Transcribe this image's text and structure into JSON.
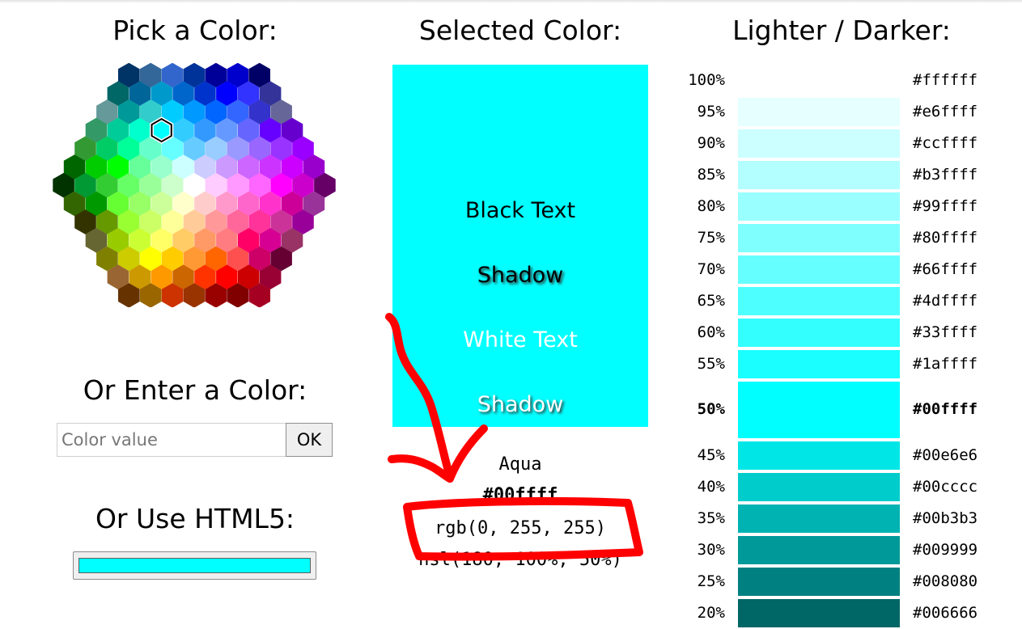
{
  "picker": {
    "title": "Pick a Color:",
    "selected_color": "#00ffff",
    "colors": [
      "#003366",
      "#336699",
      "#3366cc",
      "#003399",
      "#000099",
      "#0000cc",
      "#000066",
      "#006666",
      "#006699",
      "#0099cc",
      "#0066cc",
      "#0033cc",
      "#0000ff",
      "#3333ff",
      "#333399",
      "#669999",
      "#009999",
      "#33cccc",
      "#00ccff",
      "#0099ff",
      "#0066ff",
      "#3366ff",
      "#3333cc",
      "#666699",
      "#339966",
      "#00cc99",
      "#00ffcc",
      "#00ffff",
      "#33ccff",
      "#3399ff",
      "#6699ff",
      "#6666ff",
      "#6600ff",
      "#6600cc",
      "#339933",
      "#00cc66",
      "#00ff99",
      "#66ffcc",
      "#66ffff",
      "#66ccff",
      "#99ccff",
      "#9999ff",
      "#9966ff",
      "#9933ff",
      "#9900ff",
      "#006600",
      "#00cc00",
      "#00ff00",
      "#66ff99",
      "#99ffcc",
      "#ccffff",
      "#ccccff",
      "#cc99ff",
      "#cc66ff",
      "#cc33ff",
      "#cc00ff",
      "#9900cc",
      "#003300",
      "#009933",
      "#33cc33",
      "#66ff66",
      "#99ff99",
      "#ccffcc",
      "#ffffff",
      "#ffccff",
      "#ff99ff",
      "#ff66ff",
      "#ff00ff",
      "#cc00cc",
      "#660066",
      "#336600",
      "#009900",
      "#66ff33",
      "#99ff66",
      "#ccff99",
      "#ffffcc",
      "#ffcccc",
      "#ff99cc",
      "#ff66cc",
      "#ff33cc",
      "#cc0099",
      "#993399",
      "#333300",
      "#669900",
      "#99ff33",
      "#ccff66",
      "#ffff99",
      "#ffcc99",
      "#ff9999",
      "#ff6699",
      "#ff3399",
      "#cc3399",
      "#990099",
      "#666633",
      "#99cc00",
      "#ccff33",
      "#ffff66",
      "#ffcc66",
      "#ff9966",
      "#ff7c80",
      "#ff0066",
      "#d60093",
      "#993366",
      "#808000",
      "#cccc00",
      "#ffff00",
      "#ffcc00",
      "#ff9933",
      "#ff6600",
      "#ff5050",
      "#cc0066",
      "#660033",
      "#996633",
      "#cc9900",
      "#ff9900",
      "#cc6600",
      "#ff3300",
      "#ff0000",
      "#cc0000",
      "#990033",
      "#663300",
      "#996600",
      "#cc3300",
      "#993300",
      "#990000",
      "#800000",
      "#a50021"
    ]
  },
  "enter": {
    "title": "Or Enter a Color:",
    "placeholder": "Color value",
    "ok_label": "OK"
  },
  "html5": {
    "title": "Or Use HTML5:",
    "value": "#00ffff"
  },
  "selected": {
    "title": "Selected Color:",
    "color": "#00ffff",
    "preview_black": "Black Text",
    "preview_black_shadow": "Shadow",
    "preview_white": "White Text",
    "preview_white_shadow": "Shadow",
    "name": "Aqua",
    "hex": "#00ffff",
    "rgb": "rgb(0, 255, 255)",
    "hsl": "hsl(180, 100%, 50%)"
  },
  "shades": {
    "title": "Lighter / Darker:",
    "rows": [
      {
        "pct": "100%",
        "hex": "#ffffff"
      },
      {
        "pct": "95%",
        "hex": "#e6ffff"
      },
      {
        "pct": "90%",
        "hex": "#ccffff"
      },
      {
        "pct": "85%",
        "hex": "#b3ffff"
      },
      {
        "pct": "80%",
        "hex": "#99ffff"
      },
      {
        "pct": "75%",
        "hex": "#80ffff"
      },
      {
        "pct": "70%",
        "hex": "#66ffff"
      },
      {
        "pct": "65%",
        "hex": "#4dffff"
      },
      {
        "pct": "60%",
        "hex": "#33ffff"
      },
      {
        "pct": "55%",
        "hex": "#1affff"
      },
      {
        "pct": "50%",
        "hex": "#00ffff"
      },
      {
        "pct": "45%",
        "hex": "#00e6e6"
      },
      {
        "pct": "40%",
        "hex": "#00cccc"
      },
      {
        "pct": "35%",
        "hex": "#00b3b3"
      },
      {
        "pct": "30%",
        "hex": "#009999"
      },
      {
        "pct": "25%",
        "hex": "#008080"
      },
      {
        "pct": "20%",
        "hex": "#006666"
      }
    ]
  },
  "annotation": {
    "color": "#ff0000"
  }
}
